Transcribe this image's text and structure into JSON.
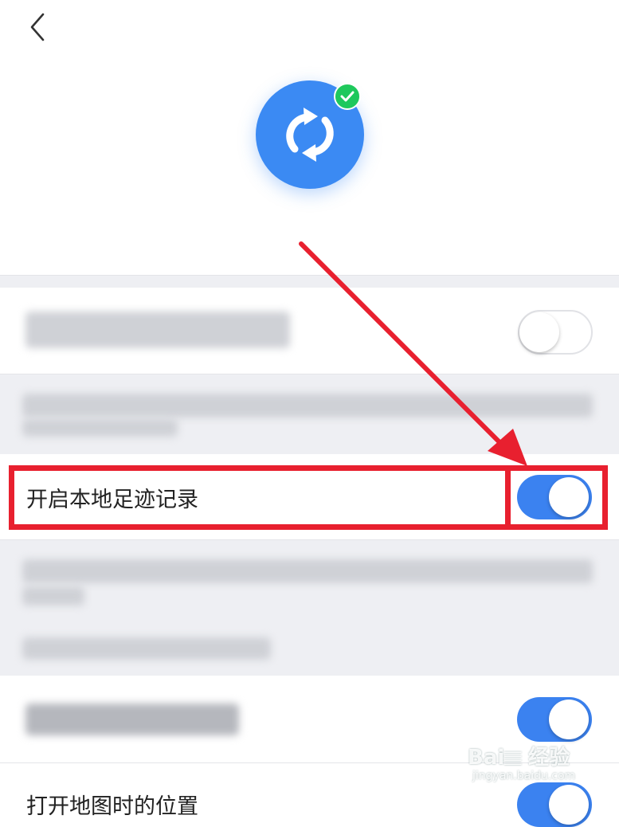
{
  "header": {
    "back_icon": "chevron-left-icon",
    "sync_icon": "sync-arrows-icon",
    "badge_icon": "check-icon",
    "accent_color": "#3b8af3",
    "badge_color": "#1ec85c"
  },
  "settings": {
    "footprint_label": "开启本地足迹记录",
    "bottom_label_partial": "打开地图时的位置",
    "toggles": {
      "row1_on": false,
      "footprint_on": true,
      "row3_on": true,
      "bottom_on": true
    }
  },
  "annotation": {
    "highlight_color": "#e8202f"
  },
  "watermark": {
    "main": "Bai𝄙 经验",
    "sub": "jingyan.baidu.com"
  }
}
